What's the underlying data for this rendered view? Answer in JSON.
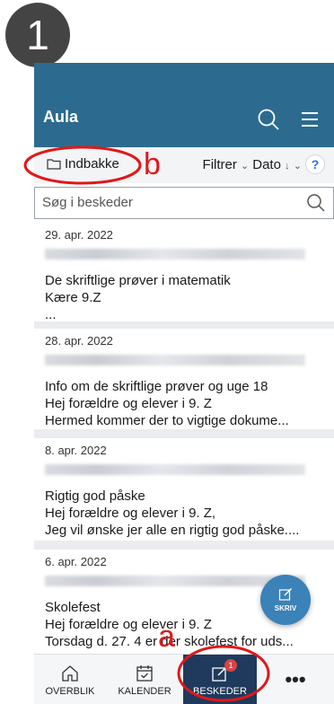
{
  "step_number": "1",
  "header": {
    "app_name": "Aula",
    "search_icon": "search-icon",
    "menu_icon": "hamburger-menu-icon"
  },
  "toolbar": {
    "inbox_label": "Indbakke",
    "filter_label": "Filtrer",
    "sort_label": "Dato",
    "help_label": "?"
  },
  "search": {
    "placeholder": "Søg i beskeder"
  },
  "messages": [
    {
      "date": "29. apr. 2022",
      "subject": "De skriftlige prøver i matematik",
      "lines": [
        "Kære 9.Z",
        "..."
      ]
    },
    {
      "date": "28. apr. 2022",
      "subject": "Info om de skriftlige prøver og uge 18",
      "lines": [
        "Hej forældre og elever i 9. Z",
        "Hermed kommer der to vigtige dokume..."
      ]
    },
    {
      "date": "8. apr. 2022",
      "subject": "Rigtig god påske",
      "lines": [
        "Hej forældre og elever i 9. Z,",
        "Jeg vil ønske jer alle en rigtig god påske...."
      ]
    },
    {
      "date": "6. apr. 2022",
      "subject": "Skolefest",
      "lines": [
        "Hej forældre og elever i 9. Z",
        "Torsdag d. 27. 4 er der skolefest for uds..."
      ]
    }
  ],
  "fab": {
    "label": "SKRIV"
  },
  "nav": {
    "overblik": "OVERBLIK",
    "kalender": "KALENDER",
    "beskeder": "BESKEDER",
    "beskeder_badge": "1",
    "more": "•••"
  },
  "annotations": {
    "a": "a",
    "b": "b",
    "color": "#e01818"
  },
  "colors": {
    "header": "#2c6b8f",
    "nav_active": "#1f3a5c",
    "fab": "#3b82b8",
    "help": "#1e73e8"
  }
}
